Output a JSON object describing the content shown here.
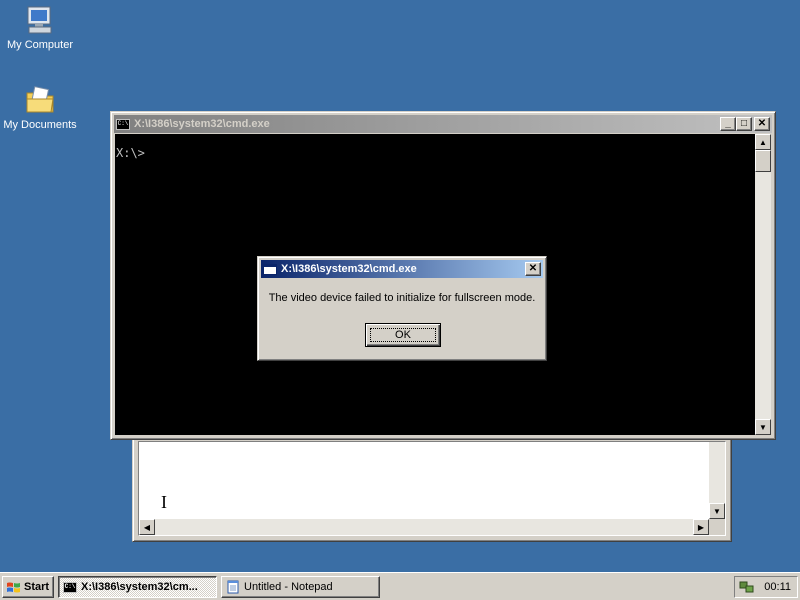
{
  "desktop": {
    "icons": [
      {
        "label": "My Computer",
        "icon": "my-computer-icon"
      },
      {
        "label": "My Documents",
        "icon": "my-documents-icon"
      }
    ],
    "background_color": "#3a6ea5"
  },
  "cmd_window": {
    "title": "X:\\I386\\system32\\cmd.exe",
    "console_text": "X:\\>",
    "icon_text": "C:\\"
  },
  "notepad_window": {
    "title": "Untitled - Notepad",
    "text": ""
  },
  "dialog": {
    "title": "X:\\I386\\system32\\cmd.exe",
    "message": "The video device failed to initialize for fullscreen mode.",
    "ok_label": "OK"
  },
  "taskbar": {
    "start_label": "Start",
    "tasks": [
      {
        "label": "X:\\I386\\system32\\cm...",
        "icon": "cmd-icon",
        "active": true
      },
      {
        "label": "Untitled - Notepad",
        "icon": "notepad-icon",
        "active": false
      }
    ],
    "clock": "00:11"
  },
  "colors": {
    "active_title_start": "#0a246a",
    "active_title_end": "#a6caf0",
    "inactive_title_start": "#808080",
    "inactive_title_end": "#c0c0c0",
    "face": "#d4d0c8"
  }
}
